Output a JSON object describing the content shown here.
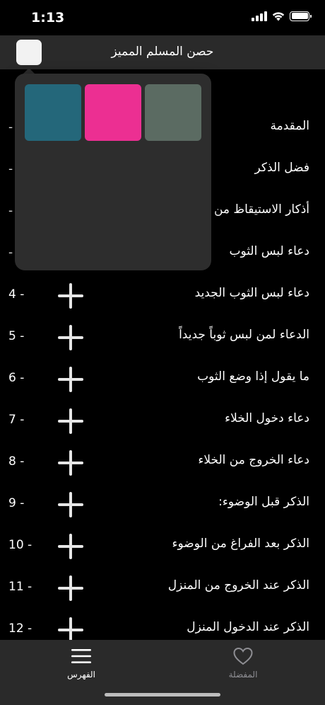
{
  "status_bar": {
    "time": "1:13"
  },
  "nav": {
    "title": "حصن المسلم المميز"
  },
  "color_picker": {
    "swatches": [
      "#24677a",
      "#ec2f92",
      "#5b6b62"
    ]
  },
  "list": {
    "rows": [
      {
        "title": "المقدمة",
        "num": "-",
        "plus": false
      },
      {
        "title": "فضل الذكر",
        "num": "-",
        "plus": false
      },
      {
        "title": "أذكار الاستيقاظ من",
        "num": "-",
        "plus": false
      },
      {
        "title": "دعاء لبس الثوب",
        "num": "-",
        "plus": false
      },
      {
        "title": "دعاء لبس الثوب الجديد",
        "num": "4 -",
        "plus": true
      },
      {
        "title": "الدعاء لمن لبس ثوباً جديداً",
        "num": "5 -",
        "plus": true
      },
      {
        "title": "ما يقول إذا وضع الثوب",
        "num": "6 -",
        "plus": true
      },
      {
        "title": "دعاء دخول الخلاء",
        "num": "7 -",
        "plus": true
      },
      {
        "title": "دعاء الخروج من الخلاء",
        "num": "8 -",
        "plus": true
      },
      {
        "title": "الذكر قبل الوضوء:",
        "num": "9 -",
        "plus": true
      },
      {
        "title": "الذكر بعد الفراغ من الوضوء",
        "num": "10 -",
        "plus": true
      },
      {
        "title": "الذكر عند الخروج من المنزل",
        "num": "11 -",
        "plus": true
      },
      {
        "title": "الذكر عند الدخول المنزل",
        "num": "12 -",
        "plus": true
      }
    ]
  },
  "tab_bar": {
    "favorites_label": "المفضلة",
    "index_label": "الفهرس"
  },
  "colors": {
    "background": "#000000",
    "bar": "#2a2a2a",
    "popover": "#2d2d2d",
    "inactive_tab": "#8e8e93"
  }
}
